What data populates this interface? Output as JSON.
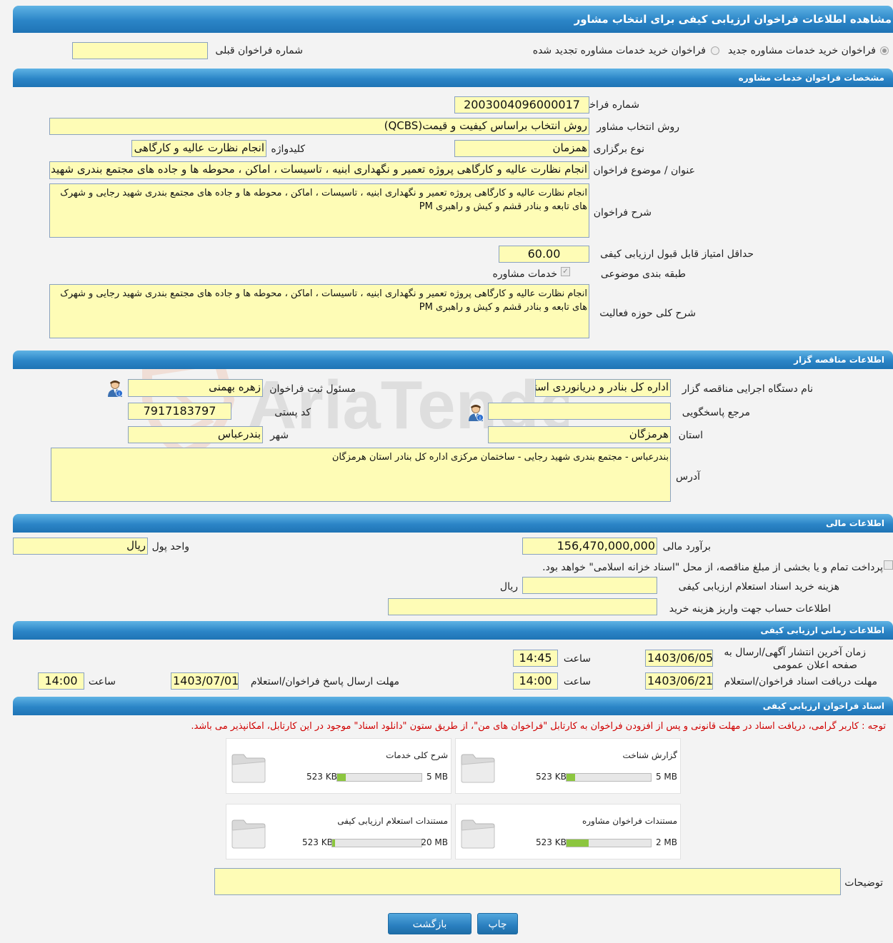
{
  "header": {
    "title": "مشاهده اطلاعات فراخوان ارزیابی کیفی برای انتخاب مشاور"
  },
  "options": {
    "radio_new": "فراخوان خرید خدمات مشاوره جدید",
    "radio_renewed": "فراخوان خرید خدمات مشاوره تجدید شده",
    "prev_label": "شماره فراخوان قبلی",
    "prev_value": ""
  },
  "sections": {
    "specs": "مشخصات فراخوان خدمات مشاوره",
    "organizer": "اطلاعات مناقصه گزار",
    "financial": "اطلاعات مالی",
    "timing": "اطلاعات زمانی ارزیابی کیفی",
    "docs": "اسناد فراخوان ارزیابی کیفی"
  },
  "specs": {
    "number_label": "شماره فراخوان",
    "number_value": "2003004096000017",
    "method_label": "روش انتخاب مشاور",
    "method_value": "روش انتخاب براساس کیفیت و قیمت(QCBS)",
    "type_label": "نوع برگزاری",
    "type_value": "همزمان",
    "keyword_label": "کلیدواژه",
    "keyword_value": "انجام نظارت عالیه و کارگاهی",
    "subject_label": "عنوان / موضوع فراخوان",
    "subject_value": "انجام نظارت عالیه و کارگاهی پروژه تعمیر و نگهداری ابنیه ، تاسیسات ، اماکن ، محوطه ها و جاده های مجتمع بندری شهید رجایی",
    "desc_label": "شرح فراخوان",
    "desc_value": "انجام نظارت عالیه و کارگاهی پروژه تعمیر و نگهداری ابنیه ، تاسیسات ، اماکن ، محوطه ها و جاده های مجتمع بندری شهید رجایی و شهرک های تابعه و بنادر قشم و کیش و راهبری PM",
    "min_score_label": "حداقل امتیاز قابل قبول ارزیابی کیفی",
    "min_score_value": "60.00",
    "category_label": "طبقه بندی موضوعی",
    "category_value": "خدمات مشاوره",
    "scope_label": "شرح کلی حوزه فعالیت",
    "scope_value": "انجام نظارت عالیه و کارگاهی پروژه تعمیر و نگهداری ابنیه ، تاسیسات ، اماکن ، محوطه ها و جاده های مجتمع بندری شهید رجایی و شهرک های تابعه و بنادر قشم و کیش و راهبری PM"
  },
  "organizer": {
    "org_label": "نام دستگاه اجرایی مناقصه گزار",
    "org_value": "اداره کل بنادر و دریانوردی استان هرمزگان",
    "registrar_label": "مسئول ثبت فراخوان",
    "registrar_value": "زهره بهمنی",
    "ref_label": "مرجع پاسخگویی",
    "ref_value": "",
    "postal_label": "کد پستی",
    "postal_value": "7917183797",
    "province_label": "استان",
    "province_value": "هرمزگان",
    "city_label": "شهر",
    "city_value": "بندرعباس",
    "address_label": "آدرس",
    "address_value": "بندرعباس - مجتمع بندری شهید رجایی - ساختمان مرکزی اداره کل بنادر استان هرمزگان"
  },
  "financial": {
    "estimate_label": "برآورد مالی",
    "estimate_value": "156,470,000,000",
    "currency_label": "واحد پول",
    "currency_value": "ریال",
    "treasury_text": "پرداخت تمام و یا بخشی از مبلغ مناقصه، از محل \"اسناد خزانه اسلامی\" خواهد بود.",
    "doc_cost_label": "هزینه خرید اسناد استعلام ارزیابی کیفی",
    "doc_cost_value": "",
    "doc_cost_unit": "ریال",
    "account_label": "اطلاعات حساب جهت واریز هزینه خرید",
    "account_value": ""
  },
  "timing": {
    "publish_label_1": "زمان آخرین انتشار آگهی/ارسال به",
    "publish_label_2": "صفحه اعلان عمومی",
    "publish_date": "1403/06/05",
    "time_label": "ساعت",
    "publish_time": "14:45",
    "receive_label": "مهلت دریافت اسناد فراخوان/استعلام",
    "receive_date": "1403/06/21",
    "receive_time": "14:00",
    "send_label": "مهلت ارسال پاسخ فراخوان/استعلام",
    "send_date": "1403/07/01",
    "send_time": "14:00"
  },
  "docs": {
    "notice": "توجه : کاربر گرامی، دریافت اسناد در مهلت قانونی و پس از افزودن فراخوان به کارتابل \"فراخوان های من\"، از طریق ستون \"دانلود اسناد\" موجود در این کارتابل، امکانپذیر می باشد.",
    "cards": [
      {
        "title": "گزارش شناخت",
        "used": "523 KB",
        "max": "5 MB",
        "fill": 0.1
      },
      {
        "title": "شرح کلی خدمات",
        "used": "523 KB",
        "max": "5 MB",
        "fill": 0.1
      },
      {
        "title": "مستندات فراخوان مشاوره",
        "used": "523 KB",
        "max": "2 MB",
        "fill": 0.26
      },
      {
        "title": "مستندات استعلام ارزیابی کیفی",
        "used": "523 KB",
        "max": "20 MB",
        "fill": 0.03
      }
    ],
    "notes_label": "توضیحات",
    "notes_value": ""
  },
  "buttons": {
    "print": "چاپ",
    "back": "بازگشت"
  },
  "icons": {
    "user": "user-info-icon",
    "folder": "folder-icon"
  },
  "colors": {
    "field_bg": "#fefcb6",
    "header_blue": "#2b85c7",
    "notice_red": "#d00000",
    "progress_green": "#8cc63f"
  }
}
